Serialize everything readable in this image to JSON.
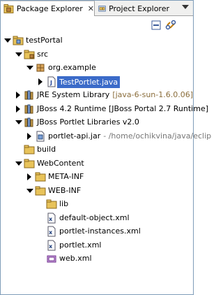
{
  "tabs": [
    {
      "label": "Package Explorer",
      "active": true,
      "close": "✕"
    },
    {
      "label": "Project Explorer",
      "active": false
    }
  ],
  "tree": [
    {
      "label": "testPortal",
      "decoration": "",
      "icon": "project-icon",
      "depth": 0,
      "twisty": "open"
    },
    {
      "label": "src",
      "decoration": "",
      "icon": "source-folder-icon",
      "depth": 1,
      "twisty": "open"
    },
    {
      "label": "org.example",
      "decoration": "",
      "icon": "package-icon",
      "depth": 2,
      "twisty": "open"
    },
    {
      "label": "TestPortlet.java",
      "decoration": "",
      "icon": "java-file-icon",
      "depth": 3,
      "twisty": "closed",
      "selected": true
    },
    {
      "label": "JRE System Library",
      "decoration": "[java-6-sun-1.6.0.06]",
      "icon": "library-icon",
      "depth": 1,
      "twisty": "closed"
    },
    {
      "label": "JBoss 4.2 Runtime [JBoss Portal 2.7 Runtime]",
      "decoration": "",
      "icon": "library-icon",
      "depth": 1,
      "twisty": "closed"
    },
    {
      "label": "JBoss Portlet Libraries v2.0",
      "decoration": "",
      "icon": "library-icon",
      "depth": 1,
      "twisty": "open"
    },
    {
      "label": "portlet-api.jar",
      "decoration": "- /home/ochikvina/java/eclip",
      "icon": "jar-icon",
      "depth": 2,
      "twisty": "closed"
    },
    {
      "label": "build",
      "decoration": "",
      "icon": "folder-icon",
      "depth": 1,
      "twisty": "none"
    },
    {
      "label": "WebContent",
      "decoration": "",
      "icon": "folder-icon",
      "depth": 1,
      "twisty": "open"
    },
    {
      "label": "META-INF",
      "decoration": "",
      "icon": "folder-icon",
      "depth": 2,
      "twisty": "closed"
    },
    {
      "label": "WEB-INF",
      "decoration": "",
      "icon": "folder-icon",
      "depth": 2,
      "twisty": "open"
    },
    {
      "label": "lib",
      "decoration": "",
      "icon": "folder-icon",
      "depth": 3,
      "twisty": "none"
    },
    {
      "label": "default-object.xml",
      "decoration": "",
      "icon": "xml-file-icon",
      "depth": 3,
      "twisty": "none"
    },
    {
      "label": "portlet-instances.xml",
      "decoration": "",
      "icon": "xml-file-icon",
      "depth": 3,
      "twisty": "none"
    },
    {
      "label": "portlet.xml",
      "decoration": "",
      "icon": "xml-file-icon",
      "depth": 3,
      "twisty": "none"
    },
    {
      "label": "web.xml",
      "decoration": "",
      "icon": "webxml-file-icon",
      "depth": 3,
      "twisty": "none"
    }
  ],
  "colors": {
    "selection": "#3b6bc9",
    "decoration": "#8a6d3b"
  }
}
